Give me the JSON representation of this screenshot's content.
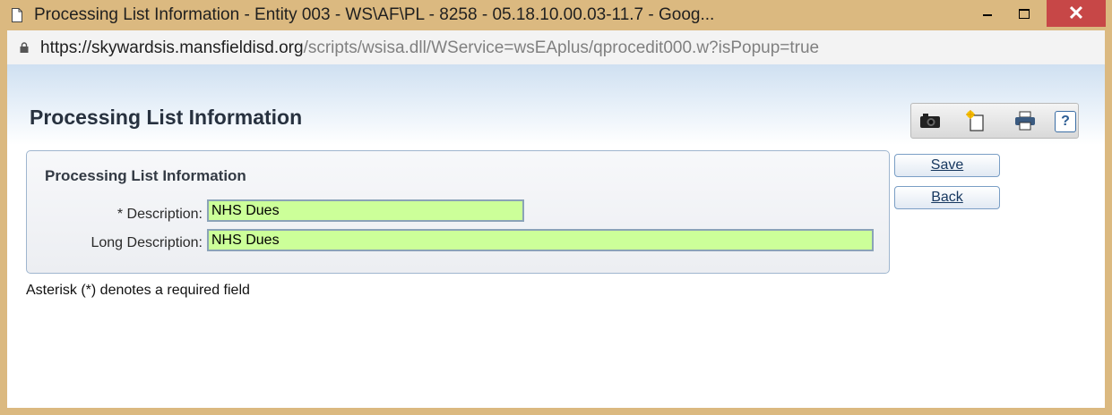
{
  "window": {
    "title": "Processing List Information - Entity 003 - WS\\AF\\PL - 8258 - 05.18.10.00.03-11.7 - Goog...",
    "close_label": "✕"
  },
  "address": {
    "host": "https://skywardsis.mansfieldisd.org",
    "path": "/scripts/wsisa.dll/WService=wsEAplus/qprocedit000.w?isPopup=true"
  },
  "page": {
    "title": "Processing List Information"
  },
  "toolbar": {
    "icons": [
      "camera-icon",
      "new-document-icon",
      "print-icon",
      "help-icon"
    ],
    "help_label": "?"
  },
  "form": {
    "section_title": "Processing List Information",
    "description_label": "* Description:",
    "description_value": "NHS Dues",
    "long_description_label": "Long Description:",
    "long_description_value": "NHS Dues"
  },
  "buttons": {
    "save": "Save",
    "back": "Back"
  },
  "note": "Asterisk (*) denotes a required field",
  "colors": {
    "frame": "#dbb980",
    "field_bg": "#ccff99",
    "close": "#c74747"
  }
}
